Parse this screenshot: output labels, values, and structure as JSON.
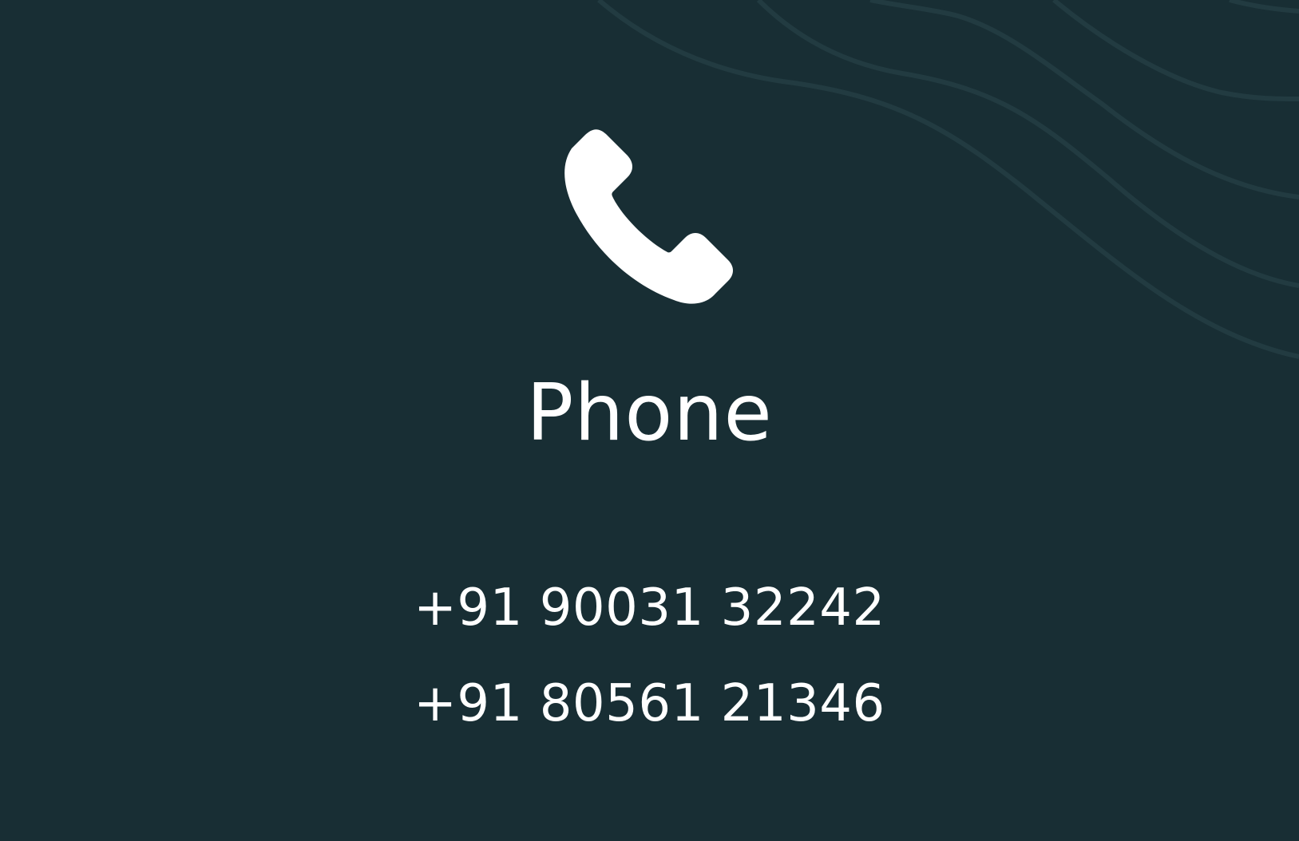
{
  "colors": {
    "background": "#182e34",
    "foreground": "#ffffff",
    "wave_stroke": "#223b41"
  },
  "icon": {
    "name": "phone-icon"
  },
  "title": "Phone",
  "phone_numbers": [
    "+91 90031 32242",
    "+91 80561 21346"
  ]
}
